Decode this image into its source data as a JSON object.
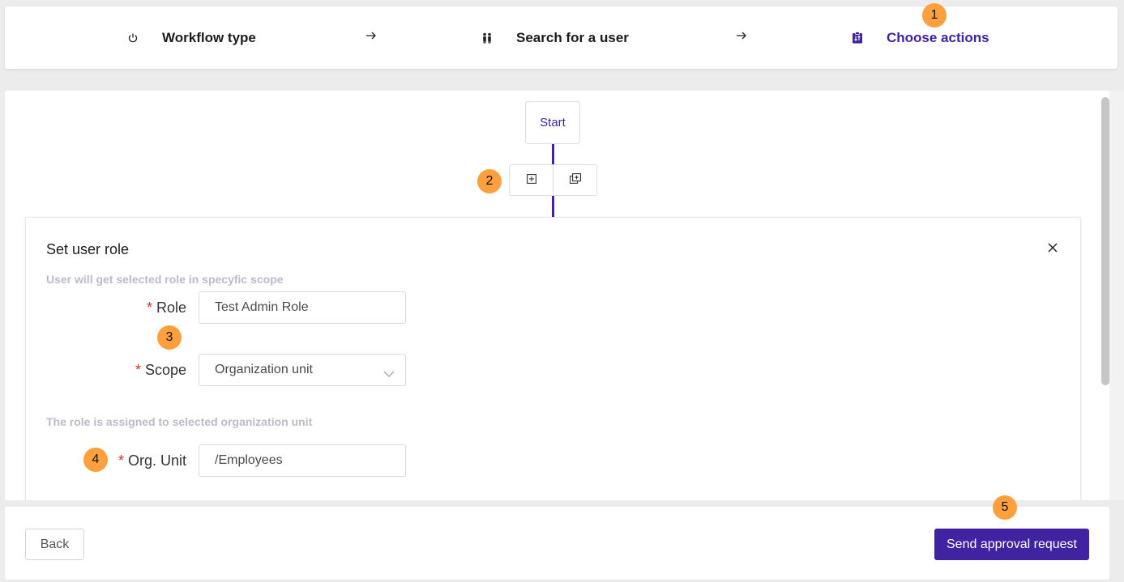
{
  "stepper": {
    "steps": [
      {
        "label": "Workflow type",
        "icon": "power-icon"
      },
      {
        "label": "Search for a user",
        "icon": "users-icon"
      },
      {
        "label": "Choose actions",
        "icon": "clipboard-swap-icon"
      }
    ],
    "active_index": 2
  },
  "badges": [
    "1",
    "2",
    "3",
    "4",
    "5"
  ],
  "canvas": {
    "start_label": "Start",
    "add_action_icon": "plus-square-icon",
    "add_group_icon": "stacked-plus-icon"
  },
  "card": {
    "title": "Set user role",
    "hint_role": "User will get selected role in specyfic scope",
    "role_label": "Role",
    "role_value": "Test Admin Role",
    "scope_label": "Scope",
    "scope_value": "Organization unit",
    "hint_scope": "The role is assigned to selected organization unit",
    "org_label": "Org. Unit",
    "org_value": "/Employees",
    "required_mark": "*"
  },
  "footer": {
    "back_label": "Back",
    "send_label": "Send approval request"
  },
  "colors": {
    "accent": "#3f23a0",
    "badge": "#ff9f3d",
    "required": "#d0312d"
  }
}
